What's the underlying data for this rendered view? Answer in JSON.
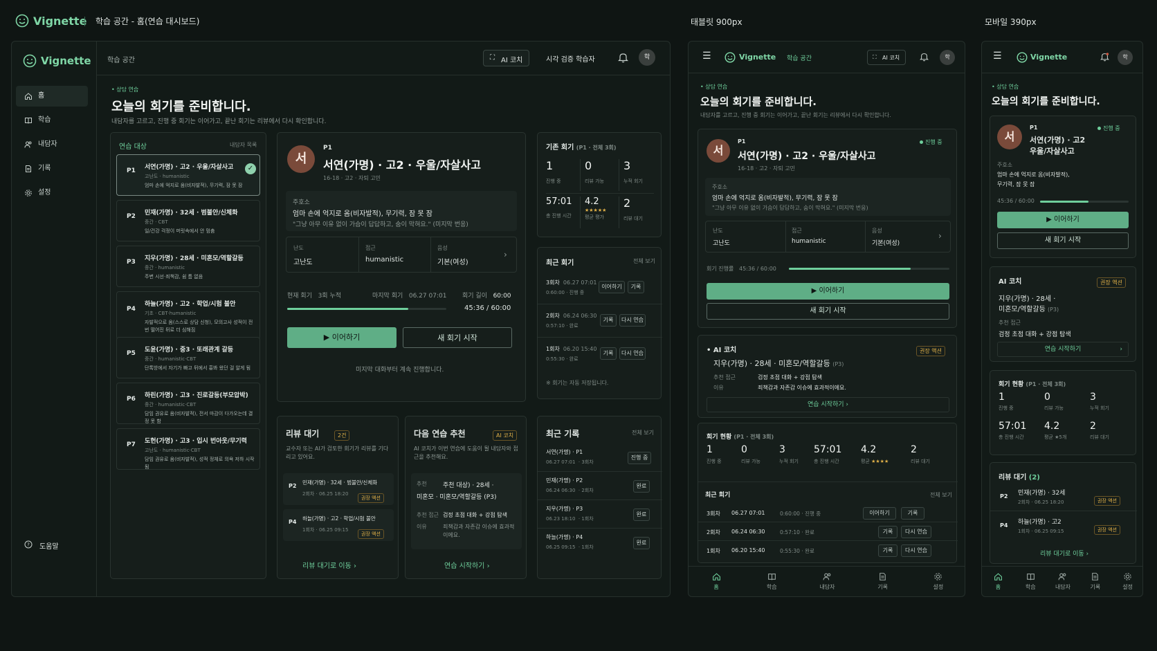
{
  "header": {
    "brand": "Vignette",
    "title": "학습 공간 - 홈(연습 대시보드)",
    "tablet_label": "태블릿 900px",
    "mobile_label": "모바일 390px"
  },
  "colors": {
    "accent": "#6fcf9c",
    "primary_button": "#5fae86",
    "background": "#0f1513",
    "warning": "#e0b048"
  },
  "desktop": {
    "brand": "Vignette",
    "breadcrumb": "학습 공간",
    "ai_coach_btn": "AI 코치",
    "visual_check": "시각 검증 학습자",
    "avatar": "학",
    "nav": [
      {
        "label": "홈",
        "icon": "home-icon"
      },
      {
        "label": "학습",
        "icon": "book-icon"
      },
      {
        "label": "내담자",
        "icon": "users-icon"
      },
      {
        "label": "기록",
        "icon": "document-icon"
      },
      {
        "label": "설정",
        "icon": "gear-icon"
      }
    ],
    "help": "도움말",
    "eyebrow": "상담 연습",
    "page_title": "오늘의 회기를 준비합니다.",
    "page_desc": "내담자를 고르고, 진행 중 회기는 이어가고, 끝난 회기는 리뷰에서 다시 확인합니다.",
    "clients_title": "연습 대상",
    "clients_link": "내담자 목록",
    "clients": [
      {
        "code": "P1",
        "name": "서연(가명) · 고2 · 우울/자살사고",
        "meta": "고난도 · humanistic",
        "desc": "엄마 손에 억지로 옴(비자발적), 무기력, 잠 못 잠"
      },
      {
        "code": "P2",
        "name": "민재(가명) · 32세 · 범불안/신체화",
        "meta": "중간 · CBT",
        "desc": "일/건강 걱정이 머릿속에서 안 멈춤"
      },
      {
        "code": "P3",
        "name": "지우(가명) · 28세 · 미혼모/역할갈등",
        "meta": "중간 · humanistic",
        "desc": "주변 시선·죄책감, 쉼 틈 없음"
      },
      {
        "code": "P4",
        "name": "하늘(가명) · 고2 · 학업/시험 불안",
        "meta": "기초 · CBT·humanistic",
        "desc": "자발적으로 옴(스스로 상담 신청), 모의고사 성적이 전 번 떨어진 뒤로 더 심해짐"
      },
      {
        "code": "P5",
        "name": "도윤(가명) · 중3 · 또래관계 갈등",
        "meta": "중간 · humanistic·CBT",
        "desc": "단톡방에서 자기가 빠고 뒤에서 흉봐 왔던 걸 알게 됨"
      },
      {
        "code": "P6",
        "name": "하린(가명) · 고3 · 진로갈등(부모압박)",
        "meta": "중간 · humanistic·CBT",
        "desc": "담임 권유로 옴(비자발적), 전서 마감이 다가오는데 결정 못 함"
      },
      {
        "code": "P7",
        "name": "도헌(가명) · 고3 · 입시 번아웃/무기력",
        "meta": "고난도 · humanistic·CBT",
        "desc": "담임 권유로 옴(비자발적), 성적 정체로 의욕 저하 시작됨"
      }
    ],
    "session": {
      "code": "P1",
      "avatar": "서",
      "name": "서연(가명) · 고2 · 우울/자살사고",
      "meta": "16-18 · 고2 · 자퇴 고민",
      "complaint_label": "주호소",
      "complaint": "엄마 손에 억지로 옴(비자발적), 무기력, 잠 못 잠",
      "quote": "\"그냥 아무 이유 없이 가슴이 답답하고, 숨이 막혀요.\" (미지막 번응)",
      "fields": [
        {
          "label": "난도",
          "value": "고난도"
        },
        {
          "label": "접근",
          "value": "humanistic"
        },
        {
          "label": "음성",
          "value": "기본(여성)"
        }
      ],
      "current": "현재 회기",
      "current_val": "3회 누적",
      "last": "마지막 회기",
      "last_val": "06.27 07:01",
      "length": "회기 길이",
      "length_val": "60:00",
      "time": "45:36 / 60:00",
      "progress": 0.76,
      "continue": "이어하기",
      "new": "새 회기 시작",
      "note": "미지막 대화부터 계속 진행합니다."
    },
    "stats": {
      "title": "기존 회기",
      "sub": "(P1 · 전체 3회)",
      "items": [
        {
          "v": "1",
          "l": "진행 중"
        },
        {
          "v": "0",
          "l": "리뷰 가능"
        },
        {
          "v": "3",
          "l": "누적 회기"
        },
        {
          "v": "57:01",
          "l": "총 진행 시간"
        },
        {
          "v": "4.2",
          "l": "평균 평가",
          "stars": "★★★★★"
        },
        {
          "v": "2",
          "l": "리뷰 대기"
        }
      ]
    },
    "recent": {
      "title": "최근 회기",
      "link": "전체 보기",
      "rows": [
        {
          "a": "3회차",
          "b": "06.27 07:01",
          "c": "0:60:00 · 진행 중",
          "btns": [
            "이어하기",
            "기록"
          ]
        },
        {
          "a": "2회차",
          "b": "06.24 06:30",
          "c": "0:57:10 · 완료",
          "btns": [
            "기록",
            "다시 연습"
          ]
        },
        {
          "a": "1회차",
          "b": "06.20 15:40",
          "c": "0:55:30 · 완료",
          "btns": [
            "기록",
            "다시 연습"
          ]
        }
      ],
      "note": "※ 회기는 자동 저장됩니다."
    },
    "review": {
      "title": "리뷰 대기",
      "count": "2건",
      "desc": "교수자 또는 AI가 검토한 회기가 리뷰를 기다리고 있어요.",
      "items": [
        {
          "code": "P2",
          "name": "민재(가명) · 32세 · 범불안/신체화",
          "meta": "2회차 · 06.25 18:20",
          "tag": "권장 액션"
        },
        {
          "code": "P4",
          "name": "하늘(가명) · 고2 · 학업/시험 불안",
          "meta": "1회차 · 06.25 09:15",
          "tag": "권장 액션"
        }
      ],
      "link": "리뷰 대기로 이동"
    },
    "next": {
      "title": "다음 연습 추천",
      "tag": "AI 코치",
      "desc": "AI 코치가 이번 연습에 도움이 될 내담자와 접근을 추천해요.",
      "target_label": "추천",
      "target": "주천 대상) · 28세 ·",
      "target2": "미혼모 · 미혼모/역할갈등 (P3)",
      "approach_label": "추천 접근",
      "approach": "검정 초점 대화 + 강점 탐색",
      "reason_label": "이유",
      "reason": "죄책감과 자존감 이슈에 효과적이에요.",
      "link": "연습 시작하기"
    },
    "records": {
      "title": "최근 기록",
      "link": "전체 보기",
      "rows": [
        {
          "name": "서연(가명) · P1",
          "date": "06.27 07:01",
          "n": "3회차",
          "status": "진행 중"
        },
        {
          "name": "민재(가명) · P2",
          "date": "06.24 06:30",
          "n": "2회차",
          "status": "완료"
        },
        {
          "name": "지우(가명) · P3",
          "date": "06.23 18:10",
          "n": "1회차",
          "status": "완료"
        },
        {
          "name": "하늘(가명) · P4",
          "date": "06.25 09:15",
          "n": "1회차",
          "status": "완료"
        }
      ]
    }
  },
  "tablet": {
    "brand": "Vignette",
    "breadcrumb": "학습 공간",
    "ai_coach": "AI 코치",
    "avatar": "학",
    "eyebrow": "상담 연습",
    "title": "오늘의 회기를 준비합니다.",
    "desc": "내담자를 고르고, 진행 중 회기는 이어가고, 끝난 회기는 리뷰에서 다시 확인합니다.",
    "session": {
      "code": "P1",
      "avatar": "서",
      "status": "진행 중",
      "name": "서연(가명) · 고2 · 우울/자살사고",
      "meta": "16-18 · 고2 · 자퇴 고민",
      "complaint_label": "주호소",
      "complaint": "엄마 손에 억지로 옴(비자발적), 무기력, 잠 못 잠",
      "quote": "\"그냥 아무 이유 없이 가슴이 답답하고, 숨이 막혀요.\" (미지막 번응)",
      "fields": [
        {
          "label": "난도",
          "value": "고난도"
        },
        {
          "label": "접근",
          "value": "humanistic"
        },
        {
          "label": "음성",
          "value": "기본(여성)"
        }
      ],
      "progress_label": "회기 진행률",
      "time": "45:36 / 60:00",
      "progress": 0.76,
      "continue": "이어하기",
      "new": "새 회기 시작"
    },
    "coach": {
      "title": "AI 코치",
      "tag": "권장 액션",
      "target": "지우(가명) · 28세 · 미혼모/역할갈등",
      "target_code": "(P3)",
      "approach_label": "추천 접근",
      "approach": "검정 초점 대화 + 강점 탐색",
      "reason_label": "이유",
      "reason": "죄책감과 자존감 이슈에 효과적이에요.",
      "link": "연습 시작하기"
    },
    "stats": {
      "title": "회기 현황",
      "sub": "(P1 · 전체 3회)",
      "items": [
        {
          "v": "1",
          "l": "진행 중"
        },
        {
          "v": "0",
          "l": "리뷰 가능"
        },
        {
          "v": "3",
          "l": "누적 회기"
        },
        {
          "v": "57:01",
          "l": "총 진행 시간"
        },
        {
          "v": "4.2",
          "l": "평균",
          "stars": "★★★★"
        },
        {
          "v": "2",
          "l": "리뷰 대기"
        }
      ]
    },
    "recent": {
      "title": "최근 회기",
      "link": "전체 보기",
      "rows": [
        {
          "a": "3회차",
          "b": "06.27 07:01",
          "c": "0:60:00 · 진행 중",
          "btns": [
            "이어하기",
            "기록"
          ]
        },
        {
          "a": "2회차",
          "b": "06.24 06:30",
          "c": "0:57:10 · 완료",
          "btns": [
            "기록",
            "다시 연습"
          ]
        },
        {
          "a": "1회차",
          "b": "06.20 15:40",
          "c": "0:55:30 · 완료",
          "btns": [
            "기록",
            "다시 연습"
          ]
        }
      ]
    },
    "tabs": [
      {
        "label": "홈",
        "icon": "home-icon"
      },
      {
        "label": "학습",
        "icon": "book-icon"
      },
      {
        "label": "내담자",
        "icon": "users-icon"
      },
      {
        "label": "기록",
        "icon": "document-icon"
      },
      {
        "label": "설정",
        "icon": "gear-icon"
      }
    ]
  },
  "mobile": {
    "brand": "Vignette",
    "avatar": "학",
    "eyebrow": "상담 연습",
    "title": "오늘의 회기를 준비합니다.",
    "session": {
      "code": "P1",
      "avatar": "서",
      "status": "진행 중",
      "name1": "서연(가명) · 고2",
      "name2": "우울/자살사고",
      "complaint_label": "주호소",
      "c1": "엄마 손에 억지로 옴(비자발적),",
      "c2": "무기력, 잠 못 잠",
      "time": "45:36 / 60:00",
      "progress": 0.55,
      "continue": "이어하기",
      "new": "새 회기 시작"
    },
    "coach": {
      "title": "AI 코치",
      "tag": "권장 액션",
      "t1": "지우(가명) · 28세 ·",
      "t2": "미혼모/역할갈등",
      "t2code": "(P3)",
      "approach_label": "추천 접근",
      "approach": "검정 초점 대화 + 강점 탐색",
      "link": "연습 시작하기"
    },
    "stats": {
      "title": "회기 현황",
      "sub": "(P1 · 전체 3회)",
      "items": [
        {
          "v": "1",
          "l": "진행 중"
        },
        {
          "v": "0",
          "l": "리뷰 가능"
        },
        {
          "v": "3",
          "l": "누적 회기"
        },
        {
          "v": "57:01",
          "l": "총 진행 시간"
        },
        {
          "v": "4.2",
          "l": "평균 ★5개"
        },
        {
          "v": "2",
          "l": "리뷰 대기"
        }
      ]
    },
    "review": {
      "title": "리뷰 대기",
      "count": "(2)",
      "items": [
        {
          "code": "P2",
          "name": "민재(가명) · 32세",
          "meta": "2회차 · 06.25 18:20",
          "tag": "권장 액션"
        },
        {
          "code": "P4",
          "name": "하늘(가명) · 고2",
          "meta": "1회차 · 06.25 09:15",
          "tag": "권장 액션"
        }
      ],
      "link": "리뷰 대기로 이동"
    },
    "tabs": [
      {
        "label": "홈",
        "icon": "home-icon"
      },
      {
        "label": "학습",
        "icon": "book-icon"
      },
      {
        "label": "내담자",
        "icon": "users-icon"
      },
      {
        "label": "기록",
        "icon": "document-icon"
      },
      {
        "label": "설정",
        "icon": "gear-icon"
      }
    ]
  }
}
